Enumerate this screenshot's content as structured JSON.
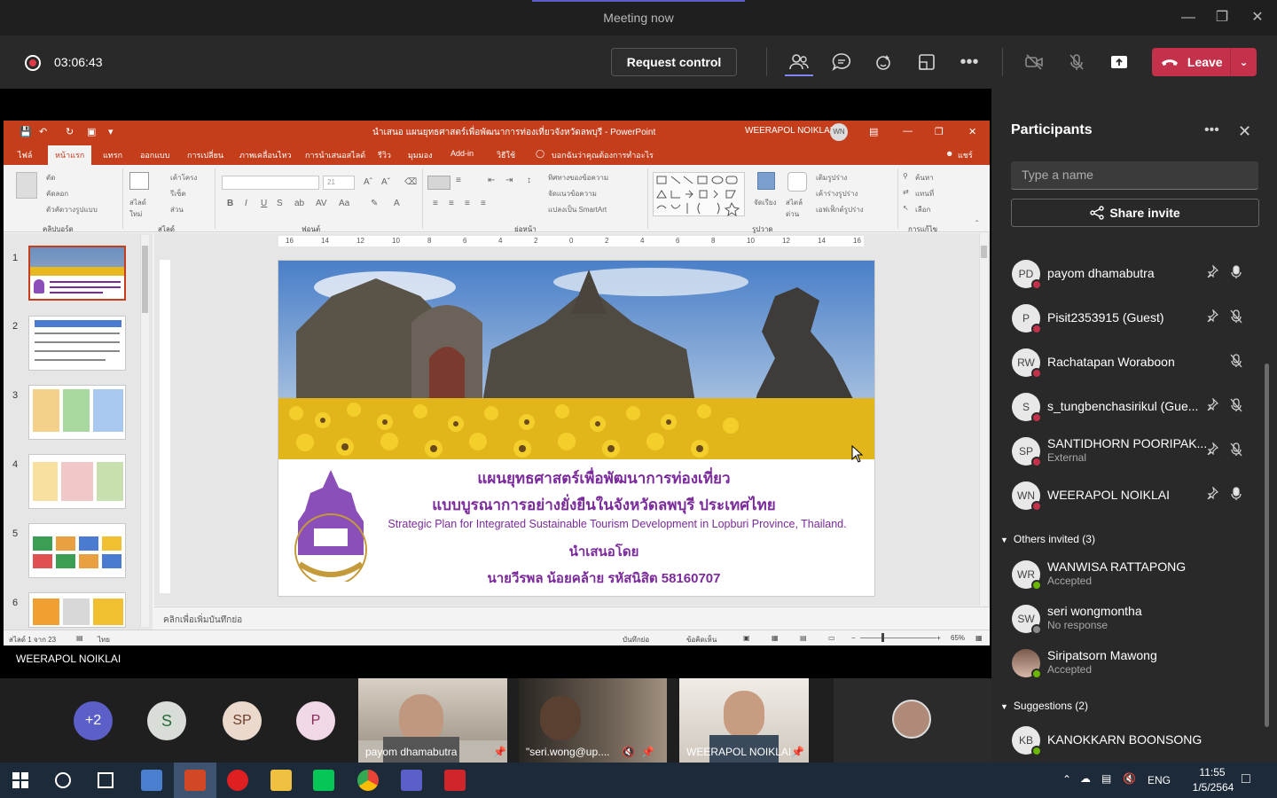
{
  "window": {
    "title": "Meeting now"
  },
  "meeting": {
    "timer": "03:06:43",
    "request_control": "Request control",
    "leave": "Leave"
  },
  "stage": {
    "presenter_name": "WEERAPOL NOIKLAI"
  },
  "powerpoint": {
    "title": "นำเสนอ แผนยุทธศาสตร์เพื่อพัฒนาการท่องเที่ยวจังหวัดลพบุรี - PowerPoint",
    "user": "WEERAPOL NOIKLAI",
    "user_initials": "WN",
    "tabs": [
      "ไฟล์",
      "หน้าแรก",
      "แทรก",
      "ออกแบบ",
      "การเปลี่ยน",
      "ภาพเคลื่อนไหว",
      "การนำเสนอสไลด์",
      "รีวิว",
      "มุมมอง",
      "Add-in",
      "วิธีใช้",
      "บอกฉันว่าคุณต้องการทำอะไร"
    ],
    "share": "แชร์",
    "ribbon_groups": [
      "คลิปบอร์ด",
      "สไลด์",
      "ฟอนต์",
      "ย่อหน้า",
      "รูปวาด",
      "การแก้ไข"
    ],
    "ribbon_labels": {
      "cut": "ตัด",
      "copy": "คัดลอก",
      "format_painter": "ตัวคัดวางรูปแบบ",
      "new_slide": "สไลด์ใหม่",
      "layout": "เค้าโครง",
      "reset": "รีเซ็ต",
      "section": "ส่วน",
      "font_size": "21",
      "text_direction": "ทิศทางของข้อความ",
      "align_text": "จัดแนวข้อความ",
      "smartart": "แปลงเป็น SmartArt",
      "arrange": "จัดเรียง",
      "quick_styles": "สไตล์ด่วน",
      "shape_fill": "เติมรูปร่าง",
      "shape_outline": "เค้าร่างรูปร่าง",
      "shape_effects": "เอฟเฟ็กต์รูปร่าง",
      "find": "ค้นหา",
      "replace": "แทนที่",
      "select": "เลือก"
    },
    "ruler_labels": [
      "16",
      "14",
      "12",
      "10",
      "8",
      "6",
      "4",
      "2",
      "0",
      "2",
      "4",
      "6",
      "8",
      "10",
      "12",
      "14",
      "16"
    ],
    "slide_numbers": [
      "1",
      "2",
      "3",
      "4",
      "5",
      "6"
    ],
    "slide": {
      "title_th_1": "แผนยุทธศาสตร์เพื่อพัฒนาการท่องเที่ยว",
      "title_th_2": "แบบบูรณาการอย่างยั่งยืนในจังหวัดลพบุรี ประเทศไทย",
      "title_en": "Strategic Plan for Integrated Sustainable Tourism Development in Lopburi Province, Thailand.",
      "presented_by": "นำเสนอโดย",
      "presenter": "นายวีรพล  น้อยคล้าย รหัสนิสิต 58160707",
      "logo_text": "มหาวิทยาลัยพะเยา"
    },
    "notes_placeholder": "คลิกเพื่อเพิ่มบันทึกย่อ",
    "status": {
      "slide_count": "สไลด์ 1 จาก 23",
      "language": "ไทย",
      "notes": "บันทึกย่อ",
      "comments": "ข้อคิดเห็น",
      "zoom": "65%"
    }
  },
  "participants": {
    "title": "Participants",
    "search_placeholder": "Type a name",
    "share_invite": "Share invite",
    "in_meeting": [
      {
        "initials": "PD",
        "name": "payom dhamabutra",
        "sub": "",
        "pinned": true,
        "mic": "on"
      },
      {
        "initials": "P",
        "name": "Pisit2353915 (Guest)",
        "sub": "",
        "pinned": true,
        "mic": "muted"
      },
      {
        "initials": "RW",
        "name": "Rachatapan Woraboon",
        "sub": "",
        "pinned": false,
        "mic": "muted"
      },
      {
        "initials": "S",
        "name": "s_tungbenchasirikul (Gue...",
        "sub": "",
        "pinned": true,
        "mic": "muted"
      },
      {
        "initials": "SP",
        "name": "SANTIDHORN POORIPAK...",
        "sub": "External",
        "pinned": true,
        "mic": "muted"
      },
      {
        "initials": "WN",
        "name": "WEERAPOL NOIKLAI",
        "sub": "",
        "pinned": true,
        "mic": "on"
      }
    ],
    "others_header": "Others invited (3)",
    "others": [
      {
        "initials": "WR",
        "name": "WANWISA RATTAPONG",
        "sub": "Accepted",
        "status_color": "#6bb700"
      },
      {
        "initials": "SW",
        "name": "seri wongmontha",
        "sub": "No response",
        "status_color": "#8a8a8a"
      },
      {
        "initials": "",
        "name": "Siripatsorn Mawong",
        "sub": "Accepted",
        "status_color": "#6bb700"
      }
    ],
    "suggestions_header": "Suggestions (2)",
    "suggestions": [
      {
        "initials": "KB",
        "name": "KANOKKARN BOONSONG",
        "sub": "",
        "status_color": "#6bb700"
      }
    ]
  },
  "video_strip": {
    "overflow": "+2",
    "avatars": [
      "S",
      "SP",
      "P"
    ],
    "tiles": [
      "payom dhamabutra",
      "\"seri.wong@up....",
      "WEERAPOL NOIKLAI"
    ]
  },
  "taskbar": {
    "language": "ENG",
    "time": "11:55",
    "date": "1/5/2564"
  },
  "colors": {
    "ppt_accent": "#c43e1c",
    "teams_accent": "#5b5fc7",
    "leave_red": "#c4314b",
    "slide_purple": "#7b2a9c"
  }
}
